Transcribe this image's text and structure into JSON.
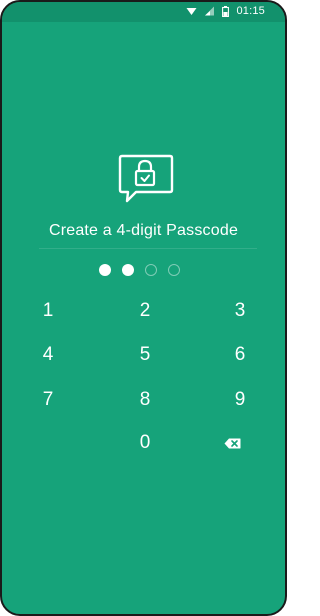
{
  "status_bar": {
    "time": "01:15",
    "icons": [
      "wifi-icon",
      "signal-icon",
      "battery-icon"
    ]
  },
  "screen": {
    "icon": "chat-lock-icon",
    "title": "Create a 4-digit Passcode",
    "passcode_length": 4,
    "digits_entered": 2
  },
  "keypad": {
    "keys": [
      "1",
      "2",
      "3",
      "4",
      "5",
      "6",
      "7",
      "8",
      "9",
      "0"
    ],
    "delete_icon": "backspace-icon"
  },
  "colors": {
    "background": "#16a37a",
    "status_bar": "#12916c",
    "foreground": "#ffffff"
  }
}
